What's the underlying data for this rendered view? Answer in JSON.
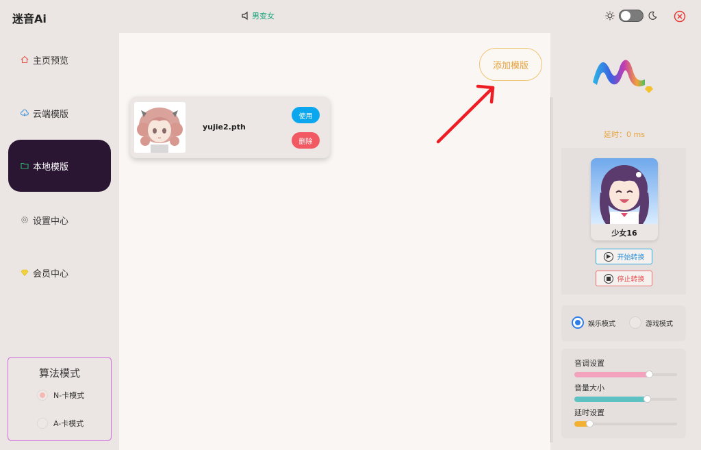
{
  "app": {
    "title": "迷音Ai"
  },
  "header": {
    "mode_label": "男变女"
  },
  "sidebar": {
    "items": [
      {
        "label": "主页预览",
        "icon": "home-icon"
      },
      {
        "label": "云端模版",
        "icon": "cloud-icon"
      },
      {
        "label": "本地模版",
        "icon": "folder-icon"
      },
      {
        "label": "设置中心",
        "icon": "gear-icon"
      },
      {
        "label": "会员中心",
        "icon": "diamond-icon"
      }
    ],
    "algo": {
      "title": "算法模式",
      "opt1": "N-卡模式",
      "opt2": "A-卡模式",
      "selected": "N-卡模式"
    }
  },
  "main": {
    "add_label": "添加模版",
    "card": {
      "name": "yujie2.pth",
      "use_label": "使用",
      "delete_label": "删除"
    }
  },
  "right": {
    "latency": "延时：0 ms",
    "avatar_name": "少女16",
    "start_label": "开始转换",
    "stop_label": "停止转换",
    "modes": {
      "opt1": "娱乐模式",
      "opt2": "游戏模式",
      "selected": "娱乐模式"
    },
    "sliders": [
      {
        "label": "音调设置",
        "value": 0.73,
        "color": "#f3a3bd"
      },
      {
        "label": "音量大小",
        "value": 0.71,
        "color": "#5ec2c2"
      },
      {
        "label": "延时设置",
        "value": 0.15,
        "color": "#f2b134"
      }
    ]
  },
  "colors": {
    "accent": "#2a1633",
    "orange": "#e6a23c",
    "blue": "#0aa6ee",
    "red": "#f25a63"
  }
}
